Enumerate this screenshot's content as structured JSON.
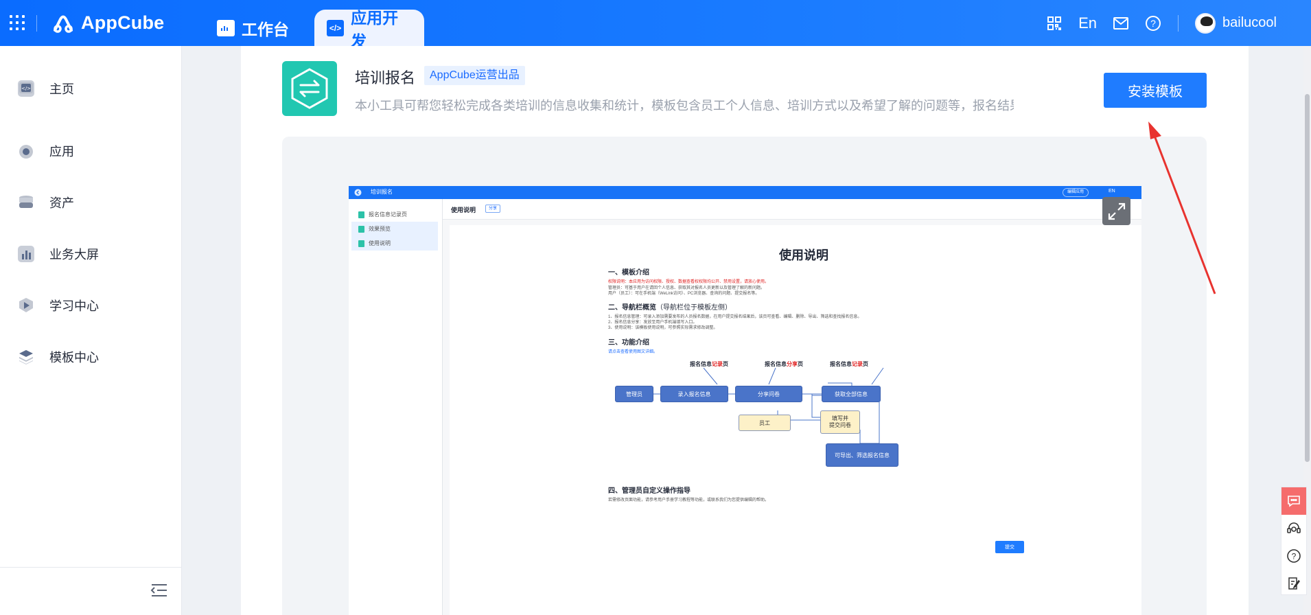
{
  "topbar": {
    "app_name": "AppCube",
    "tabs": [
      {
        "label": "工作台",
        "icon": "monitor-icon"
      },
      {
        "label": "应用开发",
        "icon": "code-icon"
      }
    ],
    "lang": "En",
    "username": "bailucool",
    "icons": [
      "app-grid-icon",
      "qrcode-icon",
      "mail-icon",
      "help-icon"
    ]
  },
  "sidebar": {
    "items": [
      {
        "label": "主页",
        "icon": "home-code-icon"
      },
      {
        "label": "应用",
        "icon": "app-cube-icon"
      },
      {
        "label": "资产",
        "icon": "database-icon"
      },
      {
        "label": "业务大屏",
        "icon": "bar-chart-icon"
      },
      {
        "label": "学习中心",
        "icon": "learning-play-icon"
      },
      {
        "label": "模板中心",
        "icon": "layers-icon"
      }
    ],
    "collapse_icon": "collapse-menu-icon"
  },
  "template": {
    "title": "培训报名",
    "badge": "AppCube运营出品",
    "description": "本小工具可帮您轻松完成各类培训的信息收集和统计，模板包含员工个人信息、培训方式以及希望了解的问题等，报名结果...",
    "install_label": "安装模板"
  },
  "preview": {
    "app_title": "培训报名",
    "top_button": "编辑应用",
    "top_lang": "EN",
    "side_items": [
      "报名信息记录页",
      "效果预览",
      "使用说明"
    ],
    "header_title": "使用说明",
    "header_share": "分享",
    "doc": {
      "title": "使用说明",
      "s1": "一、模板介绍",
      "s1_red": "权限说明：本应用为访问权限、授权、数据查看权权限均公开、禁用设置，请放心使用。",
      "s1_p1": "管理员：可基于用户在请回个人信息、获取其对报名人员更新以及管理了解的新问题。",
      "s1_p2": "用户（员工）：可在手机端（WeLink访问）、PC浏览器、查询的问题、提交报名等。",
      "s2": "二、导航栏概览",
      "s2_note": "（导航栏位于模板左侧）",
      "s2_p1": "1、报名信息管理：可录入添加需要发布的人员报名数据，在用户提交报名结果后，该页可查看、编辑、删除、导出、筛选和查找报名信息。",
      "s2_p2": "2、报名信息分享：发放至用户手机端填写入口。",
      "s2_p3": "3、使用说明：该模板使用说明，可参照实际需求修改调整。",
      "s3": "三、功能介绍",
      "s3_link": "请点击查看使用图文详细。",
      "s4": "四、管理员自定义操作指导",
      "s4_p": "若需修改页面功能，请参考用户手册学习教程等功能，或联系我们为您提供编辑的帮助。",
      "submit": "提交"
    },
    "flow": {
      "label_record_1": "报名信息",
      "label_record_1_em": "记录",
      "label_record_1_end": "页",
      "label_share": "报名信息",
      "label_share_em": "分享",
      "label_share_end": "页",
      "label_record_2": "报名信息",
      "label_record_2_em": "记录",
      "label_record_2_end": "页",
      "admin": "管理员",
      "input": "录入报名信息",
      "share": "分享问卷",
      "fetch": "获取全部信息",
      "staff": "员工",
      "fill_1": "填写并",
      "fill_2": "提交问卷",
      "export": "可导出、筛选报名信息"
    }
  },
  "float_tools": [
    "feedback-chat-icon",
    "customer-service-icon",
    "help-circle-icon",
    "edit-note-icon"
  ],
  "colors": {
    "primary": "#1f7cff",
    "topbar": "#0a6cff",
    "template_logo": "#21c7b1",
    "arrow": "#e8332f",
    "flow_box": "#4a74c9",
    "flow_box_yellow": "#fdf1c8"
  }
}
